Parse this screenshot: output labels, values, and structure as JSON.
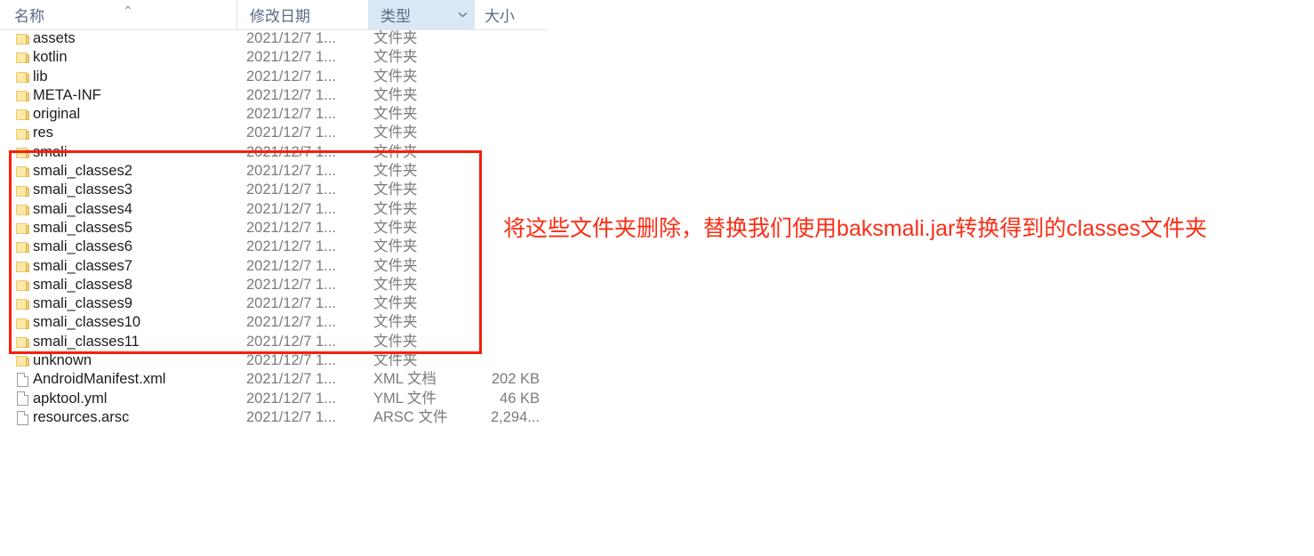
{
  "window": {
    "view": "details-list"
  },
  "columns": {
    "name": "名称",
    "date_modified": "修改日期",
    "type": "类型",
    "size": "大小",
    "type_dropdown_glyph": "⌄",
    "sort_indicator": "sort-ascending-caret"
  },
  "rows": [
    {
      "icon": "folder-icon",
      "name": "assets",
      "date": "2021/12/7 1...",
      "type": "文件夹",
      "size": ""
    },
    {
      "icon": "folder-icon",
      "name": "kotlin",
      "date": "2021/12/7 1...",
      "type": "文件夹",
      "size": ""
    },
    {
      "icon": "folder-icon",
      "name": "lib",
      "date": "2021/12/7 1...",
      "type": "文件夹",
      "size": ""
    },
    {
      "icon": "folder-icon",
      "name": "META-INF",
      "date": "2021/12/7 1...",
      "type": "文件夹",
      "size": ""
    },
    {
      "icon": "folder-icon",
      "name": "original",
      "date": "2021/12/7 1...",
      "type": "文件夹",
      "size": ""
    },
    {
      "icon": "folder-icon",
      "name": "res",
      "date": "2021/12/7 1...",
      "type": "文件夹",
      "size": ""
    },
    {
      "icon": "folder-icon",
      "name": "smali",
      "date": "2021/12/7 1...",
      "type": "文件夹",
      "size": ""
    },
    {
      "icon": "folder-icon",
      "name": "smali_classes2",
      "date": "2021/12/7 1...",
      "type": "文件夹",
      "size": ""
    },
    {
      "icon": "folder-icon",
      "name": "smali_classes3",
      "date": "2021/12/7 1...",
      "type": "文件夹",
      "size": ""
    },
    {
      "icon": "folder-icon",
      "name": "smali_classes4",
      "date": "2021/12/7 1...",
      "type": "文件夹",
      "size": ""
    },
    {
      "icon": "folder-icon",
      "name": "smali_classes5",
      "date": "2021/12/7 1...",
      "type": "文件夹",
      "size": ""
    },
    {
      "icon": "folder-icon",
      "name": "smali_classes6",
      "date": "2021/12/7 1...",
      "type": "文件夹",
      "size": ""
    },
    {
      "icon": "folder-icon",
      "name": "smali_classes7",
      "date": "2021/12/7 1...",
      "type": "文件夹",
      "size": ""
    },
    {
      "icon": "folder-icon",
      "name": "smali_classes8",
      "date": "2021/12/7 1...",
      "type": "文件夹",
      "size": ""
    },
    {
      "icon": "folder-icon",
      "name": "smali_classes9",
      "date": "2021/12/7 1...",
      "type": "文件夹",
      "size": ""
    },
    {
      "icon": "folder-icon",
      "name": "smali_classes10",
      "date": "2021/12/7 1...",
      "type": "文件夹",
      "size": ""
    },
    {
      "icon": "folder-icon",
      "name": "smali_classes11",
      "date": "2021/12/7 1...",
      "type": "文件夹",
      "size": ""
    },
    {
      "icon": "folder-icon",
      "name": "unknown",
      "date": "2021/12/7 1...",
      "type": "文件夹",
      "size": ""
    },
    {
      "icon": "file-icon",
      "name": "AndroidManifest.xml",
      "date": "2021/12/7 1...",
      "type": "XML 文档",
      "size": "202 KB"
    },
    {
      "icon": "file-icon",
      "name": "apktool.yml",
      "date": "2021/12/7 1...",
      "type": "YML 文件",
      "size": "46 KB"
    },
    {
      "icon": "file-icon",
      "name": "resources.arsc",
      "date": "2021/12/7 1...",
      "type": "ARSC 文件",
      "size": "2,294..."
    }
  ],
  "annotation": {
    "text": "将这些文件夹删除，替换我们使用baksmali.jar转换得到的classes文件夹",
    "color": "#fb2d14",
    "box_color": "#fa1e09",
    "box_covers_rows": "smali through smali_classes11"
  },
  "colors": {
    "header_text": "#5a6b86",
    "header_highlight": "#d8e8f6",
    "row_name_text": "#1c1c1c",
    "row_meta_text": "#7b7b7b",
    "folder_fill": "#fce9a8",
    "folder_tab": "#f0cf72"
  }
}
